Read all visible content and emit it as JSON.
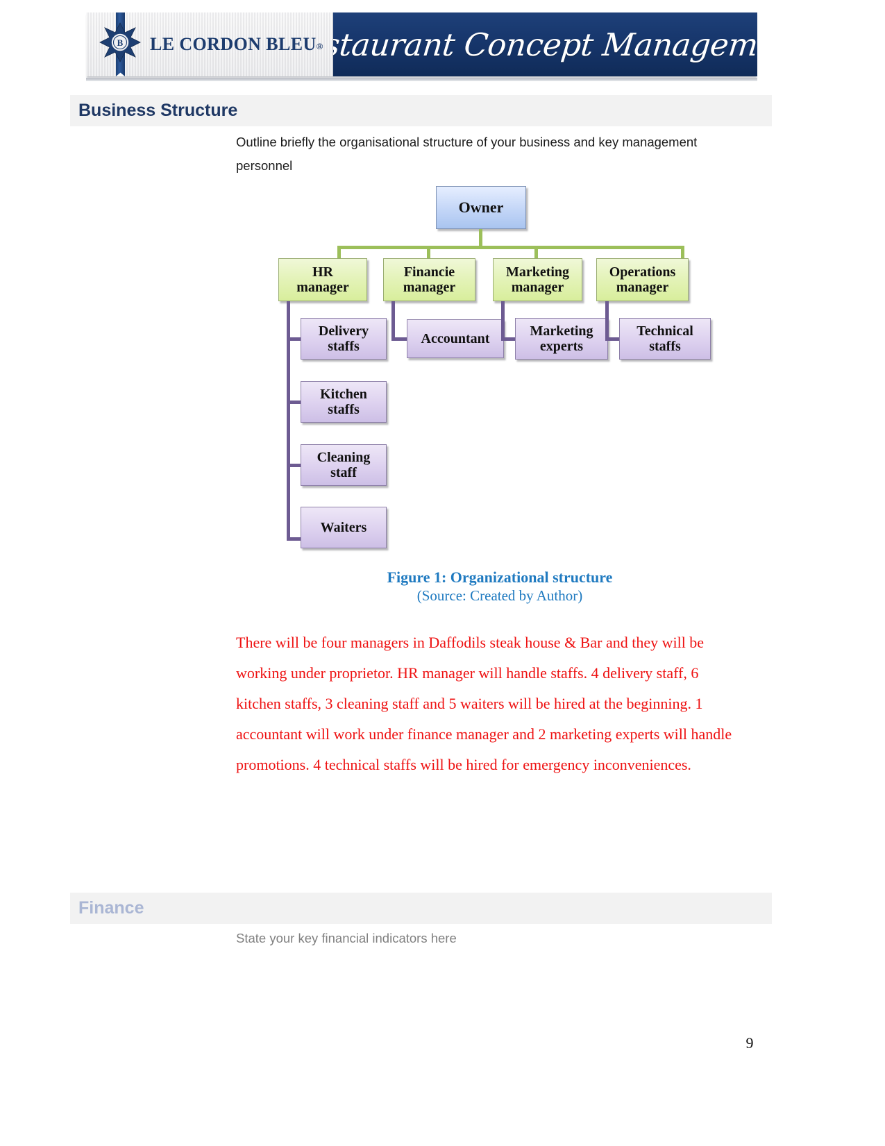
{
  "header": {
    "brand_name": "LE CORDON BLEU",
    "brand_registered": "®",
    "course_title": "Restaurant Concept Management",
    "emblem_name": "le-cordon-bleu-crest"
  },
  "sections": {
    "business_structure": {
      "heading": "Business Structure",
      "instruction": "Outline briefly the organisational structure of your business and key management personnel"
    },
    "finance": {
      "heading": "Finance",
      "instruction": "State your key financial indicators here"
    }
  },
  "figure": {
    "title": "Figure 1: Organizational structure",
    "source": "(Source: Created by Author)",
    "caption_color": "#1f7ac0"
  },
  "org_chart": {
    "owner": "Owner",
    "managers": [
      {
        "label": "HR\nmanager"
      },
      {
        "label": "Financie\nmanager"
      },
      {
        "label": "Marketing\nmanager"
      },
      {
        "label": "Operations\nmanager"
      }
    ],
    "manager_labels_flat": [
      "HR manager",
      "Financie manager",
      "Marketing manager",
      "Operations manager"
    ],
    "staff": {
      "hr": [
        "Delivery staffs",
        "Kitchen staffs",
        "Cleaning staff",
        "Waiters"
      ],
      "finance": [
        "Accountant"
      ],
      "marketing": [
        "Marketing experts"
      ],
      "operations": [
        "Technical staffs"
      ]
    },
    "colors": {
      "owner_fill": "#c3d6f7",
      "manager_fill": "#e2f2b4",
      "staff_fill": "#ddd1ef",
      "top_connector": "#9cbf5a",
      "lower_connector": "#6d5b92"
    }
  },
  "body": {
    "red_paragraph": "There will be four managers in Daffodils steak house & Bar and they will be working under proprietor. HR manager will handle staffs. 4 delivery staff, 6 kitchen staffs, 3 cleaning staff and 5 waiters will be hired at the beginning. 1 accountant will work under finance manager and 2 marketing experts will handle promotions. 4 technical staffs will be hired for emergency inconveniences.",
    "red_color": "#ee1111"
  },
  "footer": {
    "page_number": "9"
  }
}
